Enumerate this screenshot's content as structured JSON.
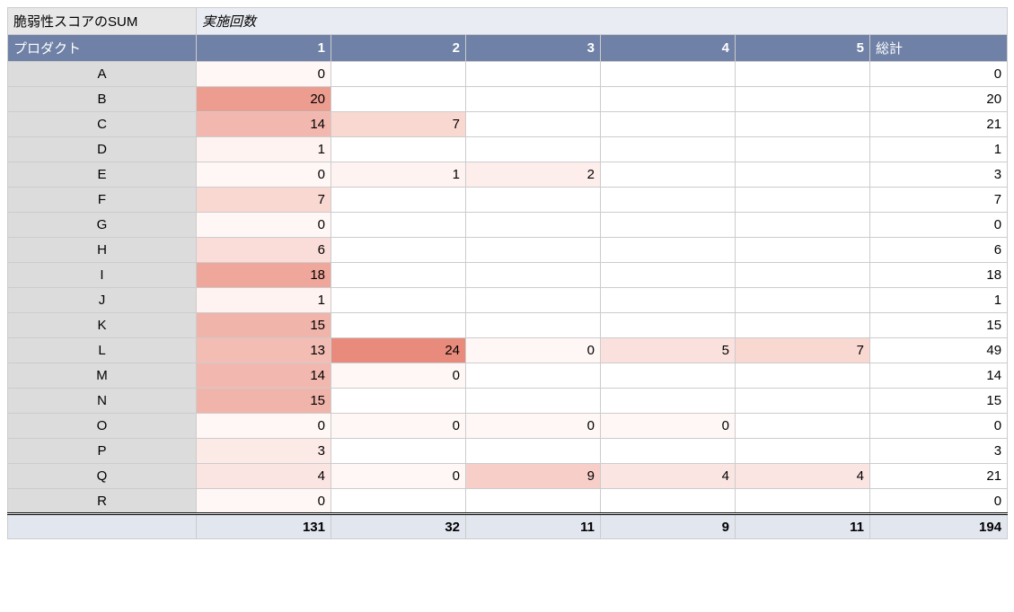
{
  "measure_label": "脆弱性スコアのSUM",
  "iteration_label": "実施回数",
  "row_field_label": "プロダクト",
  "grand_total_label": "総計",
  "col_headers": [
    "1",
    "2",
    "3",
    "4",
    "5"
  ],
  "heat_colors": {
    "max": 24,
    "palette_base": "#fff7f6",
    "palette_top": "#e98b7c"
  },
  "rows": [
    {
      "label": "A",
      "vals": [
        "0",
        "",
        "",
        "",
        ""
      ],
      "total": "0"
    },
    {
      "label": "B",
      "vals": [
        "20",
        "",
        "",
        "",
        ""
      ],
      "total": "20"
    },
    {
      "label": "C",
      "vals": [
        "14",
        "7",
        "",
        "",
        ""
      ],
      "total": "21"
    },
    {
      "label": "D",
      "vals": [
        "1",
        "",
        "",
        "",
        ""
      ],
      "total": "1"
    },
    {
      "label": "E",
      "vals": [
        "0",
        "1",
        "2",
        "",
        ""
      ],
      "total": "3"
    },
    {
      "label": "F",
      "vals": [
        "7",
        "",
        "",
        "",
        ""
      ],
      "total": "7"
    },
    {
      "label": "G",
      "vals": [
        "0",
        "",
        "",
        "",
        ""
      ],
      "total": "0"
    },
    {
      "label": "H",
      "vals": [
        "6",
        "",
        "",
        "",
        ""
      ],
      "total": "6"
    },
    {
      "label": "I",
      "vals": [
        "18",
        "",
        "",
        "",
        ""
      ],
      "total": "18"
    },
    {
      "label": "J",
      "vals": [
        "1",
        "",
        "",
        "",
        ""
      ],
      "total": "1"
    },
    {
      "label": "K",
      "vals": [
        "15",
        "",
        "",
        "",
        ""
      ],
      "total": "15"
    },
    {
      "label": "L",
      "vals": [
        "13",
        "24",
        "0",
        "5",
        "7"
      ],
      "total": "49"
    },
    {
      "label": "M",
      "vals": [
        "14",
        "0",
        "",
        "",
        ""
      ],
      "total": "14"
    },
    {
      "label": "N",
      "vals": [
        "15",
        "",
        "",
        "",
        ""
      ],
      "total": "15"
    },
    {
      "label": "O",
      "vals": [
        "0",
        "0",
        "0",
        "0",
        ""
      ],
      "total": "0"
    },
    {
      "label": "P",
      "vals": [
        "3",
        "",
        "",
        "",
        ""
      ],
      "total": "3"
    },
    {
      "label": "Q",
      "vals": [
        "4",
        "0",
        "9",
        "4",
        "4"
      ],
      "total": "21"
    },
    {
      "label": "R",
      "vals": [
        "0",
        "",
        "",
        "",
        ""
      ],
      "total": "0"
    }
  ],
  "col_totals": [
    "131",
    "32",
    "11",
    "9",
    "11"
  ],
  "grand_total": "194",
  "chart_data": {
    "type": "table",
    "row_field": "プロダクト",
    "column_field": "実施回数",
    "measure": "脆弱性スコアのSUM",
    "columns": [
      1,
      2,
      3,
      4,
      5
    ],
    "rows": {
      "A": [
        0,
        null,
        null,
        null,
        null
      ],
      "B": [
        20,
        null,
        null,
        null,
        null
      ],
      "C": [
        14,
        7,
        null,
        null,
        null
      ],
      "D": [
        1,
        null,
        null,
        null,
        null
      ],
      "E": [
        0,
        1,
        2,
        null,
        null
      ],
      "F": [
        7,
        null,
        null,
        null,
        null
      ],
      "G": [
        0,
        null,
        null,
        null,
        null
      ],
      "H": [
        6,
        null,
        null,
        null,
        null
      ],
      "I": [
        18,
        null,
        null,
        null,
        null
      ],
      "J": [
        1,
        null,
        null,
        null,
        null
      ],
      "K": [
        15,
        null,
        null,
        null,
        null
      ],
      "L": [
        13,
        24,
        0,
        5,
        7
      ],
      "M": [
        14,
        0,
        null,
        null,
        null
      ],
      "N": [
        15,
        null,
        null,
        null,
        null
      ],
      "O": [
        0,
        0,
        0,
        0,
        null
      ],
      "P": [
        3,
        null,
        null,
        null,
        null
      ],
      "Q": [
        4,
        0,
        9,
        4,
        4
      ],
      "R": [
        0,
        null,
        null,
        null,
        null
      ]
    },
    "row_totals": {
      "A": 0,
      "B": 20,
      "C": 21,
      "D": 1,
      "E": 3,
      "F": 7,
      "G": 0,
      "H": 6,
      "I": 18,
      "J": 1,
      "K": 15,
      "L": 49,
      "M": 14,
      "N": 15,
      "O": 0,
      "P": 3,
      "Q": 21,
      "R": 0
    },
    "column_totals": [
      131,
      32,
      11,
      9,
      11
    ],
    "grand_total": 194
  }
}
